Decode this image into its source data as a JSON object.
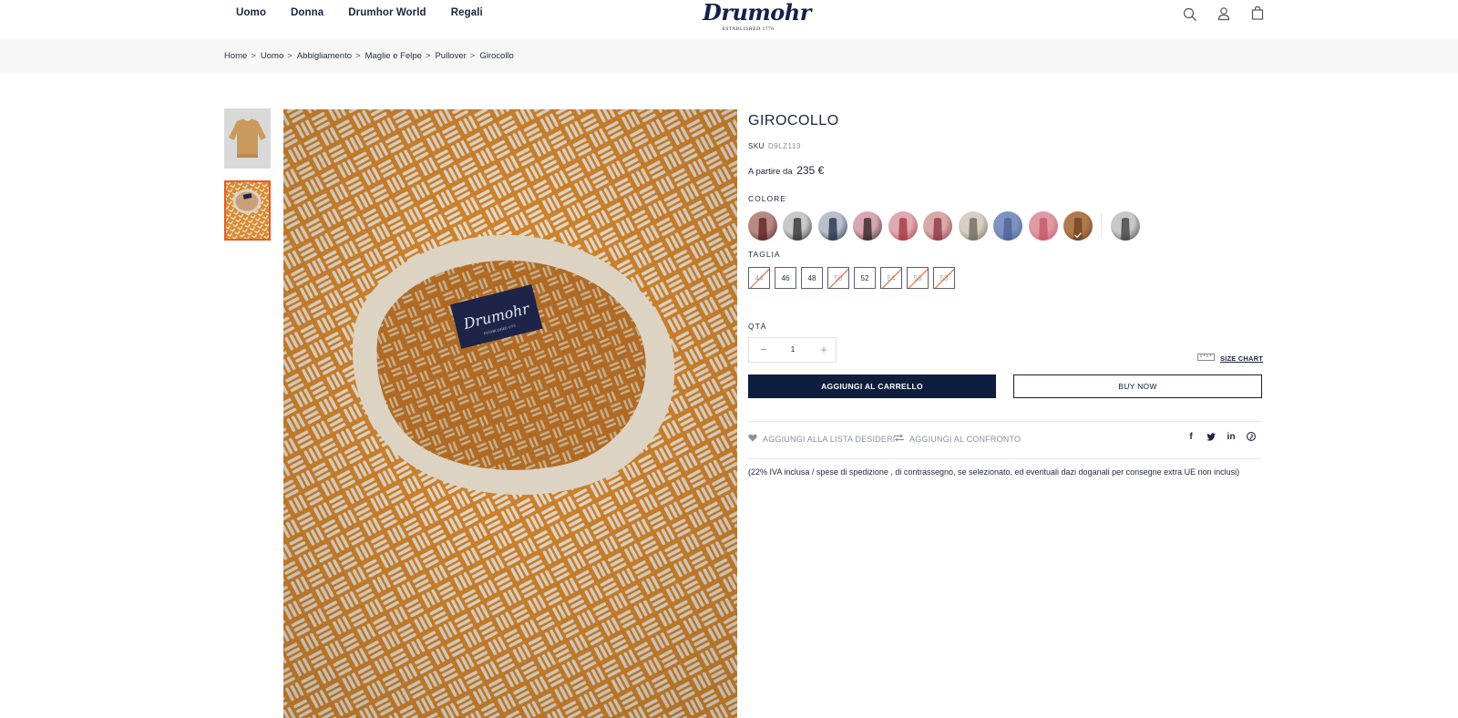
{
  "header": {
    "nav": [
      "Uomo",
      "Donna",
      "Drumhor World",
      "Regali"
    ],
    "logo": {
      "word": "Drumohr",
      "tagline": "ESTABLISHED 1770"
    }
  },
  "breadcrumb": [
    "Home",
    "Uomo",
    "Abbigliamento",
    "Maglie e Felpe",
    "Pullover",
    "Girocollo"
  ],
  "breadcrumb_sep": ">",
  "product": {
    "title": "GIROCOLLO",
    "sku_label": "SKU",
    "sku": "D9LZ113",
    "price_prefix": "A partire da",
    "price": "235 €",
    "color_label": "COLORE",
    "colors": [
      {
        "name": "swatch-1",
        "base": "#b98a82",
        "accent": "#5a1e22",
        "selected": false
      },
      {
        "name": "swatch-2",
        "base": "#c9c9c9",
        "accent": "#2a2a2a",
        "selected": false
      },
      {
        "name": "swatch-3",
        "base": "#b9c0cc",
        "accent": "#1e2a44",
        "selected": false
      },
      {
        "name": "swatch-4",
        "base": "#d8a8b2",
        "accent": "#2a2020",
        "selected": false
      },
      {
        "name": "swatch-5",
        "base": "#e0aab2",
        "accent": "#a3303a",
        "selected": false
      },
      {
        "name": "swatch-6",
        "base": "#d7a9a7",
        "accent": "#8a3040",
        "selected": false
      },
      {
        "name": "swatch-7",
        "base": "#d8cfc2",
        "accent": "#6a6558",
        "selected": false
      },
      {
        "name": "swatch-8",
        "base": "#7f93c0",
        "accent": "#4a5f94",
        "selected": false
      },
      {
        "name": "swatch-9",
        "base": "#e09aa3",
        "accent": "#c25566",
        "selected": false
      },
      {
        "name": "swatch-10",
        "base": "#b07a4e",
        "accent": "#6b4020",
        "selected": true
      },
      {
        "name": "swatch-11",
        "base": "#c8c8c8",
        "accent": "#3a3a3a",
        "selected": false
      }
    ],
    "size_label": "TAGLIA",
    "sizes": [
      {
        "label": "44",
        "available": false
      },
      {
        "label": "46",
        "available": true
      },
      {
        "label": "48",
        "available": true
      },
      {
        "label": "50",
        "available": false
      },
      {
        "label": "52",
        "available": true
      },
      {
        "label": "54",
        "available": false
      },
      {
        "label": "56",
        "available": false
      },
      {
        "label": "58",
        "available": false
      }
    ],
    "qty_label": "QTÀ",
    "qty": "1",
    "qty_minus": "−",
    "qty_plus": "+",
    "size_chart": "SIZE CHART",
    "add_to_cart": "AGGIUNGI AL CARRELLO",
    "buy_now": "BUY NOW",
    "wishlist": "AGGIUNGI ALLA LISTA DESIDERI",
    "compare": "AGGIUNGI AL CONFRONTO",
    "social": [
      "f",
      "t",
      "in",
      "p"
    ],
    "vat_note": "(22% IVA inclusa / spese di spedizione , di contrassegno, se selezionato, ed eventuali dazi doganali per consegne extra UE non inclusi)"
  },
  "colors": {
    "navy": "#0e1e3f",
    "text": "#1b2440",
    "accent_orange": "#e85b2a",
    "knit_orange": "#d98a30",
    "knit_cream": "#efe4d4"
  }
}
